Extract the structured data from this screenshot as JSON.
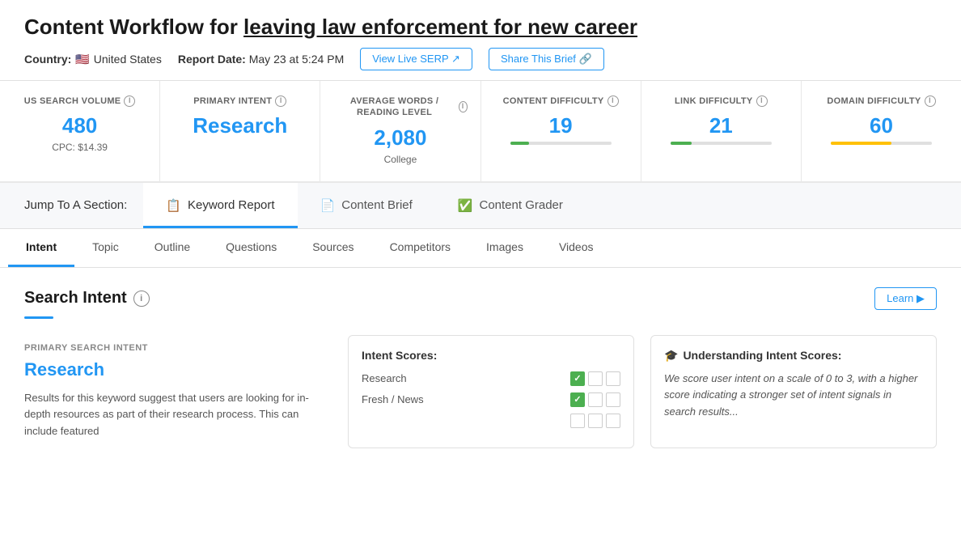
{
  "page": {
    "title_prefix": "Content Workflow for ",
    "title_link": "leaving law enforcement for new career",
    "country_label": "Country:",
    "country_flag": "🇺🇸",
    "country_name": "United States",
    "report_date_label": "Report Date:",
    "report_date_value": "May 23 at 5:24 PM",
    "view_live_serp_btn": "View Live SERP ↗",
    "share_brief_btn": "Share This Brief 🔗"
  },
  "metrics": [
    {
      "label": "US SEARCH VOLUME",
      "value": "480",
      "sub": "CPC: $14.39",
      "bar": false
    },
    {
      "label": "PRIMARY INTENT",
      "value": "Research",
      "sub": "",
      "bar": false,
      "value_blue": true
    },
    {
      "label": "AVERAGE WORDS / READING LEVEL",
      "value": "2,080",
      "sub": "College",
      "bar": false
    },
    {
      "label": "CONTENT DIFFICULTY",
      "value": "19",
      "sub": "",
      "bar": true,
      "bar_color": "#4caf50",
      "bar_pct": 19
    },
    {
      "label": "LINK DIFFICULTY",
      "value": "21",
      "sub": "",
      "bar": true,
      "bar_color": "#4caf50",
      "bar_pct": 21
    },
    {
      "label": "DOMAIN DIFFICULTY",
      "value": "60",
      "sub": "",
      "bar": true,
      "bar_color": "#ffc107",
      "bar_pct": 60
    }
  ],
  "section_nav": {
    "label": "Jump To A Section:",
    "tabs": [
      {
        "id": "keyword-report",
        "icon": "📋",
        "label": "Keyword Report",
        "active": true
      },
      {
        "id": "content-brief",
        "icon": "📄",
        "label": "Content Brief",
        "active": false
      },
      {
        "id": "content-grader",
        "icon": "✅",
        "label": "Content Grader",
        "active": false
      }
    ]
  },
  "sub_tabs": [
    {
      "label": "Intent",
      "active": true
    },
    {
      "label": "Topic",
      "active": false
    },
    {
      "label": "Outline",
      "active": false
    },
    {
      "label": "Questions",
      "active": false
    },
    {
      "label": "Sources",
      "active": false
    },
    {
      "label": "Competitors",
      "active": false
    },
    {
      "label": "Images",
      "active": false
    },
    {
      "label": "Videos",
      "active": false
    }
  ],
  "search_intent": {
    "section_title": "Search Intent",
    "learn_btn": "Learn ▶",
    "primary_label": "PRIMARY SEARCH INTENT",
    "primary_value": "Research",
    "description": "Results for this keyword suggest that users are looking for in-depth resources as part of their research process. This can include featured",
    "intent_scores_title": "Intent Scores:",
    "intent_rows": [
      {
        "label": "Research",
        "checked": [
          true,
          false,
          false
        ]
      },
      {
        "label": "Fresh / News",
        "checked": [
          true,
          false,
          false
        ]
      },
      {
        "label": "",
        "checked": [
          false,
          false,
          false
        ]
      }
    ],
    "understanding_title": "Understanding Intent Scores:",
    "understanding_icon": "🎓",
    "understanding_text": "We score user intent on a scale of 0 to 3, with a higher score indicating a stronger set of intent signals in search results..."
  }
}
